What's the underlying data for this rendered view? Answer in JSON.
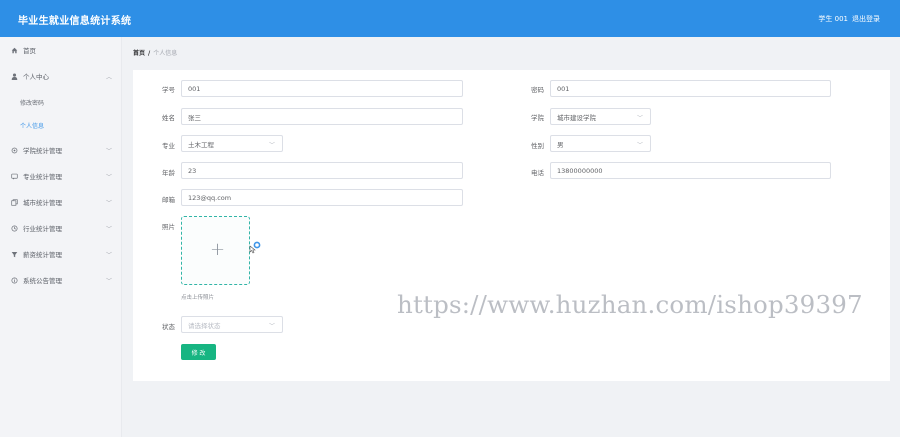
{
  "header": {
    "app_title": "毕业生就业信息统计系统",
    "user_label": "学生 001",
    "logout_label": "退出登录"
  },
  "sidebar": {
    "items": [
      {
        "label": "首页",
        "icon": "home-icon"
      },
      {
        "label": "个人中心",
        "icon": "user-icon"
      },
      {
        "label": "学院统计管理",
        "icon": "settings-icon"
      },
      {
        "label": "专业统计管理",
        "icon": "chat-icon"
      },
      {
        "label": "城市统计管理",
        "icon": "copy-icon"
      },
      {
        "label": "行业统计管理",
        "icon": "clock-icon"
      },
      {
        "label": "薪资统计管理",
        "icon": "filter-icon"
      },
      {
        "label": "系统公告管理",
        "icon": "info-icon"
      }
    ],
    "sub_items": [
      {
        "label": "修改密码"
      },
      {
        "label": "个人信息"
      }
    ]
  },
  "breadcrumb": {
    "home": "首页",
    "separator": "/",
    "current": "个人信息"
  },
  "form": {
    "student_no": {
      "label": "学号",
      "value": "001"
    },
    "password": {
      "label": "密码",
      "value": "001"
    },
    "name": {
      "label": "姓名",
      "value": "张三"
    },
    "college": {
      "label": "学院",
      "value": "城市建设学院"
    },
    "major": {
      "label": "专业",
      "value": "土木工程"
    },
    "gender": {
      "label": "性别",
      "value": "男"
    },
    "age": {
      "label": "年龄",
      "value": "23"
    },
    "phone": {
      "label": "电话",
      "value": "13800000000"
    },
    "email": {
      "label": "邮箱",
      "value": "123@qq.com"
    },
    "photo": {
      "label": "照片",
      "tip": "点击上传照片"
    },
    "status": {
      "label": "状态",
      "placeholder": "请选择状态"
    },
    "submit_label": "修 改"
  },
  "watermark": "https://www.huzhan.com/ishop39397",
  "colors": {
    "header_bg": "#2e8fe6",
    "active_link": "#3e95e8",
    "button_bg": "#17b582",
    "upload_border": "#32b5a7"
  }
}
